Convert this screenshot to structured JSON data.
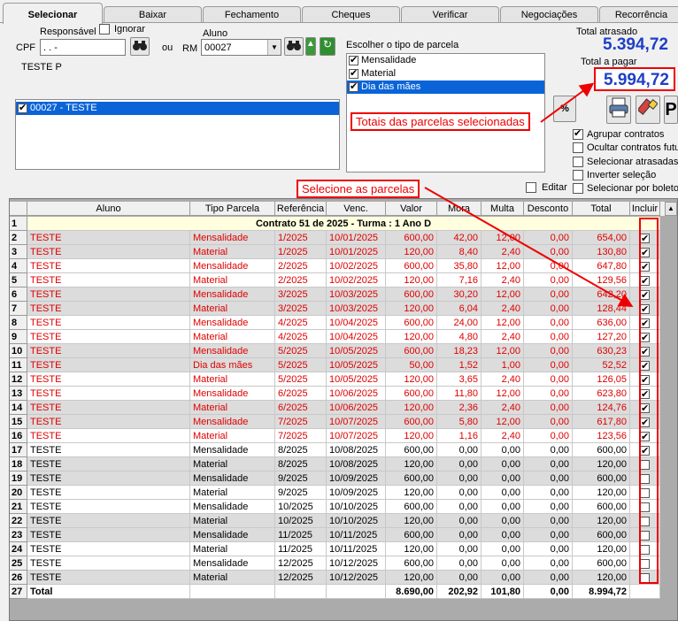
{
  "tabs": [
    "Selecionar",
    "Baixar",
    "Fechamento",
    "Cheques",
    "Verificar",
    "Negociações",
    "Recorrência"
  ],
  "form": {
    "responsavel_label": "Responsável",
    "ignorar_label": "Ignorar",
    "cpf_label": "CPF",
    "cpf_value": " .    .    -",
    "ou_label": "ou",
    "aluno_label": "Aluno",
    "rm_label": "RM",
    "rm_value": "00027",
    "responsavel_name": "TESTE P",
    "student_list": [
      "00027 - TESTE"
    ]
  },
  "parcela": {
    "label": "Escolher o tipo de parcela",
    "options": [
      {
        "label": "Mensalidade",
        "checked": true
      },
      {
        "label": "Material",
        "checked": true
      },
      {
        "label": "Dia das mães",
        "checked": true
      }
    ],
    "percent_label": "%"
  },
  "totals": {
    "atrasado_label": "Total atrasado",
    "atrasado_value": "5.394,72",
    "pagar_label": "Total a pagar",
    "pagar_value": "5.994,72"
  },
  "options": [
    {
      "label": "Agrupar contratos",
      "checked": true
    },
    {
      "label": "Ocultar contratos futuros",
      "checked": false
    },
    {
      "label": "Selecionar atrasadas",
      "checked": false
    },
    {
      "label": "Inverter seleção",
      "checked": false
    },
    {
      "label": "Selecionar por boleto",
      "checked": false
    }
  ],
  "editar_label": "Editar",
  "annotations": {
    "totais": "Totais das parcelas selecionadas",
    "selecione": "Selecione as parcelas"
  },
  "grid": {
    "headers": [
      "Aluno",
      "Tipo Parcela",
      "Referência",
      "Venc.",
      "Valor",
      "Mora",
      "Multa",
      "Desconto",
      "Total",
      "Incluir"
    ],
    "group_row": "Contrato 51 de 2025 - Turma : 1 Ano D",
    "rows": [
      {
        "n": "2",
        "aluno": "TESTE",
        "tipo": "Mensalidade",
        "ref": "1/2025",
        "venc": "10/01/2025",
        "valor": "600,00",
        "mora": "42,00",
        "multa": "12,00",
        "desc": "0,00",
        "total": "654,00",
        "inc": true,
        "late": true
      },
      {
        "n": "3",
        "aluno": "TESTE",
        "tipo": "Material",
        "ref": "1/2025",
        "venc": "10/01/2025",
        "valor": "120,00",
        "mora": "8,40",
        "multa": "2,40",
        "desc": "0,00",
        "total": "130,80",
        "inc": true,
        "late": true
      },
      {
        "n": "4",
        "aluno": "TESTE",
        "tipo": "Mensalidade",
        "ref": "2/2025",
        "venc": "10/02/2025",
        "valor": "600,00",
        "mora": "35,80",
        "multa": "12,00",
        "desc": "0,00",
        "total": "647,80",
        "inc": true,
        "late": true
      },
      {
        "n": "5",
        "aluno": "TESTE",
        "tipo": "Material",
        "ref": "2/2025",
        "venc": "10/02/2025",
        "valor": "120,00",
        "mora": "7,16",
        "multa": "2,40",
        "desc": "0,00",
        "total": "129,56",
        "inc": true,
        "late": true
      },
      {
        "n": "6",
        "aluno": "TESTE",
        "tipo": "Mensalidade",
        "ref": "3/2025",
        "venc": "10/03/2025",
        "valor": "600,00",
        "mora": "30,20",
        "multa": "12,00",
        "desc": "0,00",
        "total": "642,20",
        "inc": true,
        "late": true
      },
      {
        "n": "7",
        "aluno": "TESTE",
        "tipo": "Material",
        "ref": "3/2025",
        "venc": "10/03/2025",
        "valor": "120,00",
        "mora": "6,04",
        "multa": "2,40",
        "desc": "0,00",
        "total": "128,44",
        "inc": true,
        "late": true
      },
      {
        "n": "8",
        "aluno": "TESTE",
        "tipo": "Mensalidade",
        "ref": "4/2025",
        "venc": "10/04/2025",
        "valor": "600,00",
        "mora": "24,00",
        "multa": "12,00",
        "desc": "0,00",
        "total": "636,00",
        "inc": true,
        "late": true
      },
      {
        "n": "9",
        "aluno": "TESTE",
        "tipo": "Material",
        "ref": "4/2025",
        "venc": "10/04/2025",
        "valor": "120,00",
        "mora": "4,80",
        "multa": "2,40",
        "desc": "0,00",
        "total": "127,20",
        "inc": true,
        "late": true
      },
      {
        "n": "10",
        "aluno": "TESTE",
        "tipo": "Mensalidade",
        "ref": "5/2025",
        "venc": "10/05/2025",
        "valor": "600,00",
        "mora": "18,23",
        "multa": "12,00",
        "desc": "0,00",
        "total": "630,23",
        "inc": true,
        "late": true
      },
      {
        "n": "11",
        "aluno": "TESTE",
        "tipo": "Dia das mães",
        "ref": "5/2025",
        "venc": "10/05/2025",
        "valor": "50,00",
        "mora": "1,52",
        "multa": "1,00",
        "desc": "0,00",
        "total": "52,52",
        "inc": true,
        "late": true
      },
      {
        "n": "12",
        "aluno": "TESTE",
        "tipo": "Material",
        "ref": "5/2025",
        "venc": "10/05/2025",
        "valor": "120,00",
        "mora": "3,65",
        "multa": "2,40",
        "desc": "0,00",
        "total": "126,05",
        "inc": true,
        "late": true
      },
      {
        "n": "13",
        "aluno": "TESTE",
        "tipo": "Mensalidade",
        "ref": "6/2025",
        "venc": "10/06/2025",
        "valor": "600,00",
        "mora": "11,80",
        "multa": "12,00",
        "desc": "0,00",
        "total": "623,80",
        "inc": true,
        "late": true
      },
      {
        "n": "14",
        "aluno": "TESTE",
        "tipo": "Material",
        "ref": "6/2025",
        "venc": "10/06/2025",
        "valor": "120,00",
        "mora": "2,36",
        "multa": "2,40",
        "desc": "0,00",
        "total": "124,76",
        "inc": true,
        "late": true
      },
      {
        "n": "15",
        "aluno": "TESTE",
        "tipo": "Mensalidade",
        "ref": "7/2025",
        "venc": "10/07/2025",
        "valor": "600,00",
        "mora": "5,80",
        "multa": "12,00",
        "desc": "0,00",
        "total": "617,80",
        "inc": true,
        "late": true
      },
      {
        "n": "16",
        "aluno": "TESTE",
        "tipo": "Material",
        "ref": "7/2025",
        "venc": "10/07/2025",
        "valor": "120,00",
        "mora": "1,16",
        "multa": "2,40",
        "desc": "0,00",
        "total": "123,56",
        "inc": true,
        "late": true
      },
      {
        "n": "17",
        "aluno": "TESTE",
        "tipo": "Mensalidade",
        "ref": "8/2025",
        "venc": "10/08/2025",
        "valor": "600,00",
        "mora": "0,00",
        "multa": "0,00",
        "desc": "0,00",
        "total": "600,00",
        "inc": true,
        "late": false
      },
      {
        "n": "18",
        "aluno": "TESTE",
        "tipo": "Material",
        "ref": "8/2025",
        "venc": "10/08/2025",
        "valor": "120,00",
        "mora": "0,00",
        "multa": "0,00",
        "desc": "0,00",
        "total": "120,00",
        "inc": false,
        "late": false
      },
      {
        "n": "19",
        "aluno": "TESTE",
        "tipo": "Mensalidade",
        "ref": "9/2025",
        "venc": "10/09/2025",
        "valor": "600,00",
        "mora": "0,00",
        "multa": "0,00",
        "desc": "0,00",
        "total": "600,00",
        "inc": false,
        "late": false
      },
      {
        "n": "20",
        "aluno": "TESTE",
        "tipo": "Material",
        "ref": "9/2025",
        "venc": "10/09/2025",
        "valor": "120,00",
        "mora": "0,00",
        "multa": "0,00",
        "desc": "0,00",
        "total": "120,00",
        "inc": false,
        "late": false
      },
      {
        "n": "21",
        "aluno": "TESTE",
        "tipo": "Mensalidade",
        "ref": "10/2025",
        "venc": "10/10/2025",
        "valor": "600,00",
        "mora": "0,00",
        "multa": "0,00",
        "desc": "0,00",
        "total": "600,00",
        "inc": false,
        "late": false
      },
      {
        "n": "22",
        "aluno": "TESTE",
        "tipo": "Material",
        "ref": "10/2025",
        "venc": "10/10/2025",
        "valor": "120,00",
        "mora": "0,00",
        "multa": "0,00",
        "desc": "0,00",
        "total": "120,00",
        "inc": false,
        "late": false
      },
      {
        "n": "23",
        "aluno": "TESTE",
        "tipo": "Mensalidade",
        "ref": "11/2025",
        "venc": "10/11/2025",
        "valor": "600,00",
        "mora": "0,00",
        "multa": "0,00",
        "desc": "0,00",
        "total": "600,00",
        "inc": false,
        "late": false
      },
      {
        "n": "24",
        "aluno": "TESTE",
        "tipo": "Material",
        "ref": "11/2025",
        "venc": "10/11/2025",
        "valor": "120,00",
        "mora": "0,00",
        "multa": "0,00",
        "desc": "0,00",
        "total": "120,00",
        "inc": false,
        "late": false
      },
      {
        "n": "25",
        "aluno": "TESTE",
        "tipo": "Mensalidade",
        "ref": "12/2025",
        "venc": "10/12/2025",
        "valor": "600,00",
        "mora": "0,00",
        "multa": "0,00",
        "desc": "0,00",
        "total": "600,00",
        "inc": false,
        "late": false
      },
      {
        "n": "26",
        "aluno": "TESTE",
        "tipo": "Material",
        "ref": "12/2025",
        "venc": "10/12/2025",
        "valor": "120,00",
        "mora": "0,00",
        "multa": "0,00",
        "desc": "0,00",
        "total": "120,00",
        "inc": false,
        "late": false
      }
    ],
    "total_row": {
      "n": "27",
      "label": "Total",
      "valor": "8.690,00",
      "mora": "202,92",
      "multa": "101,80",
      "desc": "0,00",
      "total": "8.994,72"
    }
  },
  "colors": {
    "late_text": "#e00000",
    "accent_blue": "#1e3fc8",
    "selection": "#0a64d8"
  }
}
